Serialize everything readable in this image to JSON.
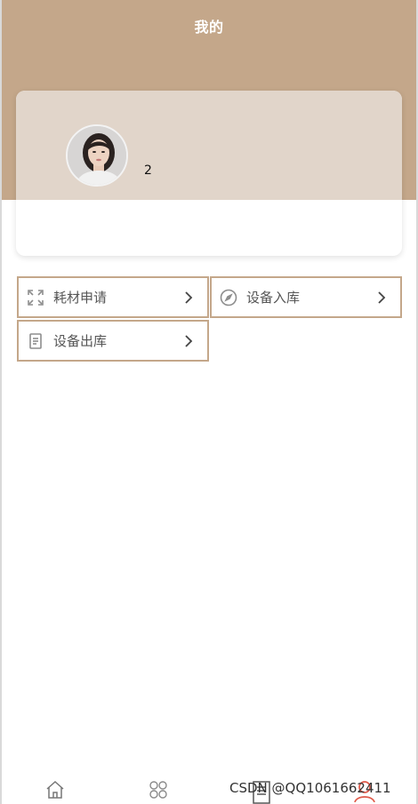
{
  "header": {
    "title": "我的",
    "background_color": "#c4a78a"
  },
  "profile": {
    "avatar_icon": "user-photo",
    "name": "2",
    "card_top_color": "#e1d5ca"
  },
  "menu": {
    "items": [
      {
        "label": "耗材申请",
        "icon": "expand-icon",
        "arrow": "chevron-right-icon"
      },
      {
        "label": "设备入库",
        "icon": "compass-icon",
        "arrow": "chevron-right-icon"
      },
      {
        "label": "设备出库",
        "icon": "document-icon",
        "arrow": "chevron-right-icon"
      }
    ],
    "border_color": "#c4a78a"
  },
  "tabbar": {
    "tabs": [
      {
        "icon": "home-icon",
        "active": false
      },
      {
        "icon": "grid-icon",
        "active": false
      },
      {
        "icon": "document-icon",
        "active": false
      },
      {
        "icon": "user-icon",
        "active": true
      }
    ],
    "active_color": "#e05a4a"
  },
  "watermark": {
    "text": "CSDN @QQ1061662411"
  }
}
